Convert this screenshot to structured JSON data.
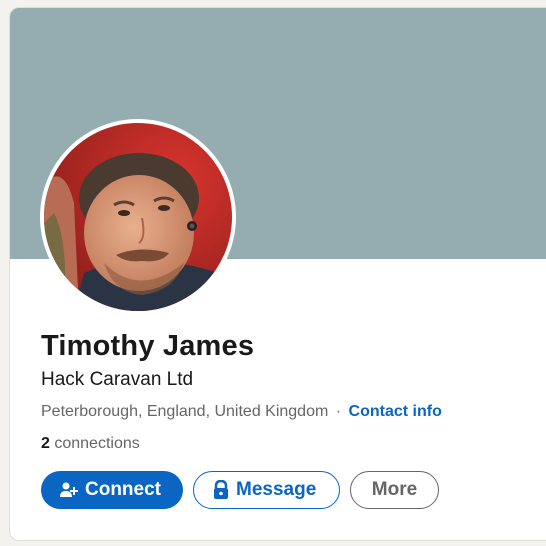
{
  "profile": {
    "name": "Timothy James",
    "headline": "Hack Caravan Ltd",
    "location": "Peterborough, England, United Kingdom",
    "separator": "·",
    "contact_info": "Contact info",
    "connections_count": "2",
    "connections_label": " connections"
  },
  "actions": {
    "connect_label": "Connect",
    "message_label": "Message",
    "more_label": "More"
  },
  "icons": {
    "connect": "add-person-icon",
    "message": "lock-icon",
    "avatar": "profile-photo"
  },
  "colors": {
    "brand": "#0a66c2",
    "cover": "#95adb0",
    "text": "#191919",
    "muted": "#666666"
  }
}
